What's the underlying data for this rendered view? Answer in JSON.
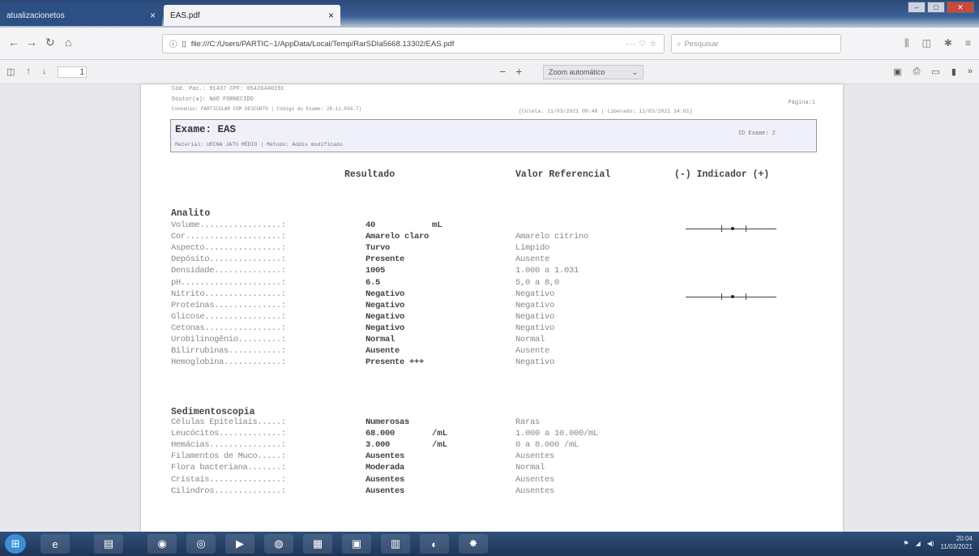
{
  "browser": {
    "tabs": [
      {
        "label": "atualizacionetos"
      },
      {
        "label": "EAS.pdf"
      }
    ],
    "url": "file:///C:/Users/PARTIC~1/AppData/Local/Temp/RarSDIa5668.13302/EAS.pdf",
    "url_meta": "··· ♡ ☆",
    "search_placeholder": "Pesquisar",
    "page_number": "1",
    "zoom_label": "Zoom automático"
  },
  "report": {
    "header_line1": "Cód. Pac.: 91437       CPF: 05426440191",
    "header_line2": "Doutor(a): NAO FORNECIDO",
    "header_line3": "Convenio: PARTICULAR COM DESCONTO | Código do Exame: 28.11.034-7)",
    "header_page": "Página:1",
    "header_dates": "[Coleta: 11/03/2021 09:40 | Liberado: 11/03/2021 14:01]",
    "exam_title": "Exame: EAS",
    "exam_material": "Material: URINA JATO MÉDIO | Método: Addis modificado",
    "exam_id": "ID Exame: 2",
    "col_result": "Resultado",
    "col_ref": "Valor Referencial",
    "col_indicator": "(-) Indicador (+)",
    "section1": "Analito",
    "section2": "Sedimentoscopia",
    "rows1": [
      {
        "name": "Volume.................:",
        "value": "40",
        "unit": "mL",
        "ref": ""
      },
      {
        "name": "Cor....................:",
        "value": "Amarelo claro",
        "unit": "",
        "ref": "Amarelo citrino"
      },
      {
        "name": "Aspecto................:",
        "value": "Turvo",
        "unit": "",
        "ref": "Límpido"
      },
      {
        "name": "Depósito...............:",
        "value": "Presente",
        "unit": "",
        "ref": "Ausente"
      },
      {
        "name": "Densidade..............:",
        "value": "1005",
        "unit": "",
        "ref": "1.000 a 1.031"
      },
      {
        "name": "pH.....................:",
        "value": "6.5",
        "unit": "",
        "ref": "5,0 a 8,0"
      },
      {
        "name": "Nitrito................:",
        "value": "Negativo",
        "unit": "",
        "ref": "Negativo"
      },
      {
        "name": "Proteínas..............:",
        "value": "Negativo",
        "unit": "",
        "ref": "Negativo"
      },
      {
        "name": "Glicose................:",
        "value": "Negativo",
        "unit": "",
        "ref": "Negativo"
      },
      {
        "name": "Cetonas................:",
        "value": "Negativo",
        "unit": "",
        "ref": "Negativo"
      },
      {
        "name": "Urobilinogênio.........:",
        "value": "Normal",
        "unit": "",
        "ref": "Normal"
      },
      {
        "name": "Bilirrubinas...........:",
        "value": "Ausente",
        "unit": "",
        "ref": "Ausente"
      },
      {
        "name": "Hemoglobina............:",
        "value": "Presente +++",
        "unit": "",
        "ref": "Negativo"
      }
    ],
    "rows2": [
      {
        "name": "Células Epiteliais.....:",
        "value": "Numerosas",
        "unit": "",
        "ref": "Raras"
      },
      {
        "name": "Leucócitos.............:",
        "value": "68.000",
        "unit": "/mL",
        "ref": "1.000 a 10.000/mL"
      },
      {
        "name": "Hemácias...............:",
        "value": "3.000",
        "unit": "/mL",
        "ref": "0 a 8.000 /mL"
      },
      {
        "name": "Filamentos de Muco.....:",
        "value": "Ausentes",
        "unit": "",
        "ref": "Ausentes"
      },
      {
        "name": "Flora bacteriana.......:",
        "value": "Moderada",
        "unit": "",
        "ref": "Normal"
      },
      {
        "name": "Cristais...............:",
        "value": "Ausentes",
        "unit": "",
        "ref": "Ausentes"
      },
      {
        "name": "Cilindros..............:",
        "value": "Ausentes",
        "unit": "",
        "ref": "Ausentes"
      }
    ]
  },
  "taskbar": {
    "time": "20:04",
    "date": "11/03/2021"
  }
}
